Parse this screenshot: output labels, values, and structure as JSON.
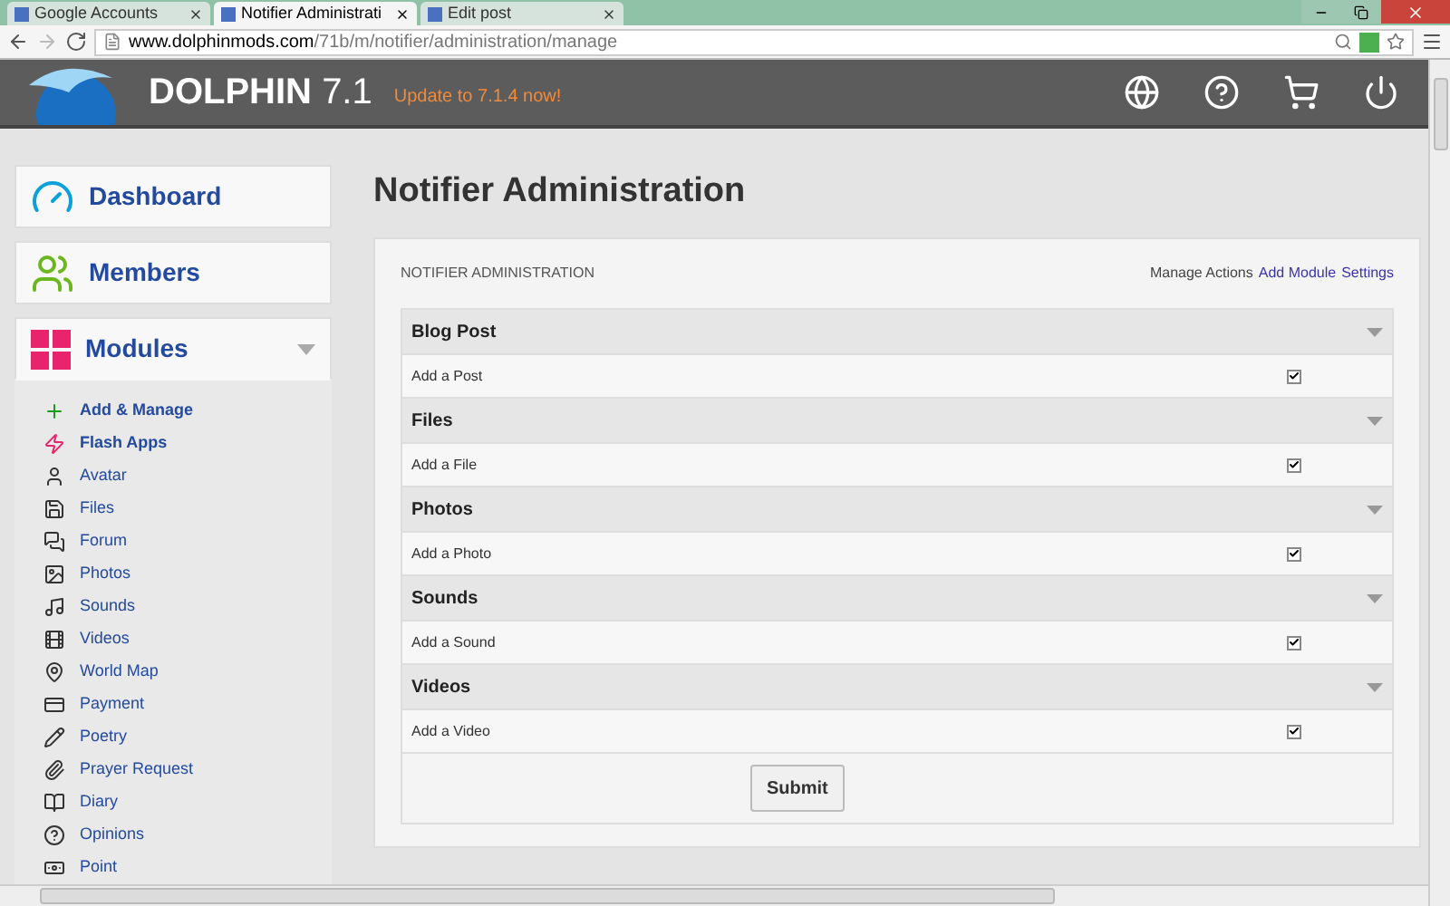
{
  "browser": {
    "tabs": [
      {
        "title": "Google Accounts",
        "selected": false
      },
      {
        "title": "Notifier Administrati",
        "selected": true
      },
      {
        "title": "Edit post",
        "selected": false
      }
    ],
    "url_host": "www.dolphinmods.com",
    "url_path": "/71b/m/notifier/administration/manage"
  },
  "header": {
    "brand": "DOLPHIN",
    "version": "7.1",
    "update_link": "Update to 7.1.4 now!"
  },
  "sidebar": {
    "cards": [
      {
        "label": "Dashboard",
        "expanded": false,
        "kind": "plain"
      },
      {
        "label": "Members",
        "expanded": false,
        "kind": "plain"
      },
      {
        "label": "Modules",
        "expanded": true,
        "kind": "collapsible"
      }
    ],
    "items": [
      {
        "label": "Add & Manage",
        "highlighted": true
      },
      {
        "label": "Flash Apps",
        "highlighted": true
      },
      {
        "label": "Avatar",
        "highlighted": false
      },
      {
        "label": "Files",
        "highlighted": false
      },
      {
        "label": "Forum",
        "highlighted": false
      },
      {
        "label": "Photos",
        "highlighted": false
      },
      {
        "label": "Sounds",
        "highlighted": false
      },
      {
        "label": "Videos",
        "highlighted": false
      },
      {
        "label": "World Map",
        "highlighted": false
      },
      {
        "label": "Payment",
        "highlighted": false
      },
      {
        "label": "Poetry",
        "highlighted": false
      },
      {
        "label": "Prayer Request",
        "highlighted": false
      },
      {
        "label": "Diary",
        "highlighted": false
      },
      {
        "label": "Opinions",
        "highlighted": false
      },
      {
        "label": "Point",
        "highlighted": false
      }
    ]
  },
  "main": {
    "title": "Notifier Administration",
    "panel_title": "NOTIFIER ADMINISTRATION",
    "actions": [
      {
        "label": "Manage Actions",
        "selected": true
      },
      {
        "label": "Add Module",
        "selected": false
      },
      {
        "label": "Settings",
        "selected": false
      }
    ],
    "sections": [
      {
        "title": "Blog Post",
        "rows": [
          {
            "label": "Add a Post",
            "checked": true
          }
        ]
      },
      {
        "title": "Files",
        "rows": [
          {
            "label": "Add a File",
            "checked": true
          }
        ]
      },
      {
        "title": "Photos",
        "rows": [
          {
            "label": "Add a Photo",
            "checked": true
          }
        ]
      },
      {
        "title": "Sounds",
        "rows": [
          {
            "label": "Add a Sound",
            "checked": true
          }
        ]
      },
      {
        "title": "Videos",
        "rows": [
          {
            "label": "Add a Video",
            "checked": true
          }
        ]
      }
    ],
    "submit": "Submit"
  }
}
